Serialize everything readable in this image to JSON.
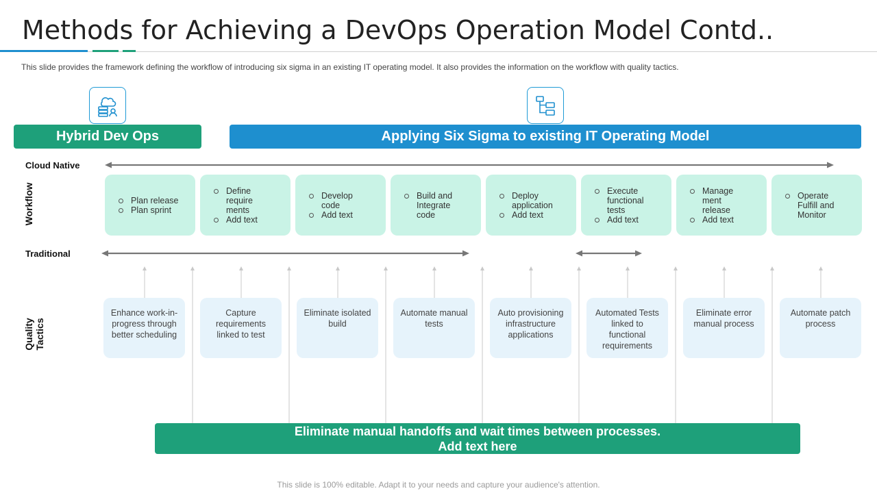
{
  "slide": {
    "title": "Methods for Achieving a DevOps Operation Model Contd..",
    "subtitle": "This slide provides  the framework  defining  the workflow  of introducing six sigma in an existing IT  operating  model.  It also provides  the information  on the workflow with quality tactics.",
    "footer": "This slide is 100% editable. Adapt it to your needs and capture your audience's attention."
  },
  "colors": {
    "green": "#1ea07a",
    "blue": "#1e8fcf",
    "workflow_box": "#c9f3e6",
    "quality_box": "#e6f3fb"
  },
  "banners": {
    "hybrid": "Hybrid Dev Ops",
    "six_sigma": "Applying Six Sigma to existing IT Operating Model"
  },
  "icons": {
    "hybrid": "cloud-database-user-icon",
    "six_sigma": "hierarchy-flow-icon"
  },
  "rows": {
    "cloud_native": "Cloud Native",
    "traditional": "Traditional",
    "workflow": "Workflow",
    "quality_line1": "Quality",
    "quality_line2": "Tactics"
  },
  "workflow": [
    {
      "items": [
        "Plan release",
        "Plan sprint"
      ]
    },
    {
      "items": [
        "Define require ments",
        "Add text"
      ]
    },
    {
      "items": [
        "Develop code",
        "Add text"
      ]
    },
    {
      "items": [
        "Build and Integrate code"
      ]
    },
    {
      "items": [
        "Deploy application",
        "Add text"
      ]
    },
    {
      "items": [
        "Execute functional tests",
        "Add text"
      ]
    },
    {
      "items": [
        "Manage ment release",
        "Add text"
      ]
    },
    {
      "items": [
        "Operate Fulfill and Monitor"
      ]
    }
  ],
  "quality_tactics": [
    "Enhance work-in-progress through better scheduling",
    "Capture requirements linked to test",
    "Eliminate isolated build",
    "Automate manual tests",
    "Auto provisioning infrastructure applications",
    "Automated Tests linked to functional requirements",
    "Eliminate error manual process",
    "Automate patch process"
  ],
  "bottom_banner": {
    "line1": "Eliminate manual handoffs and wait times between processes.",
    "line2": "Add text here"
  }
}
